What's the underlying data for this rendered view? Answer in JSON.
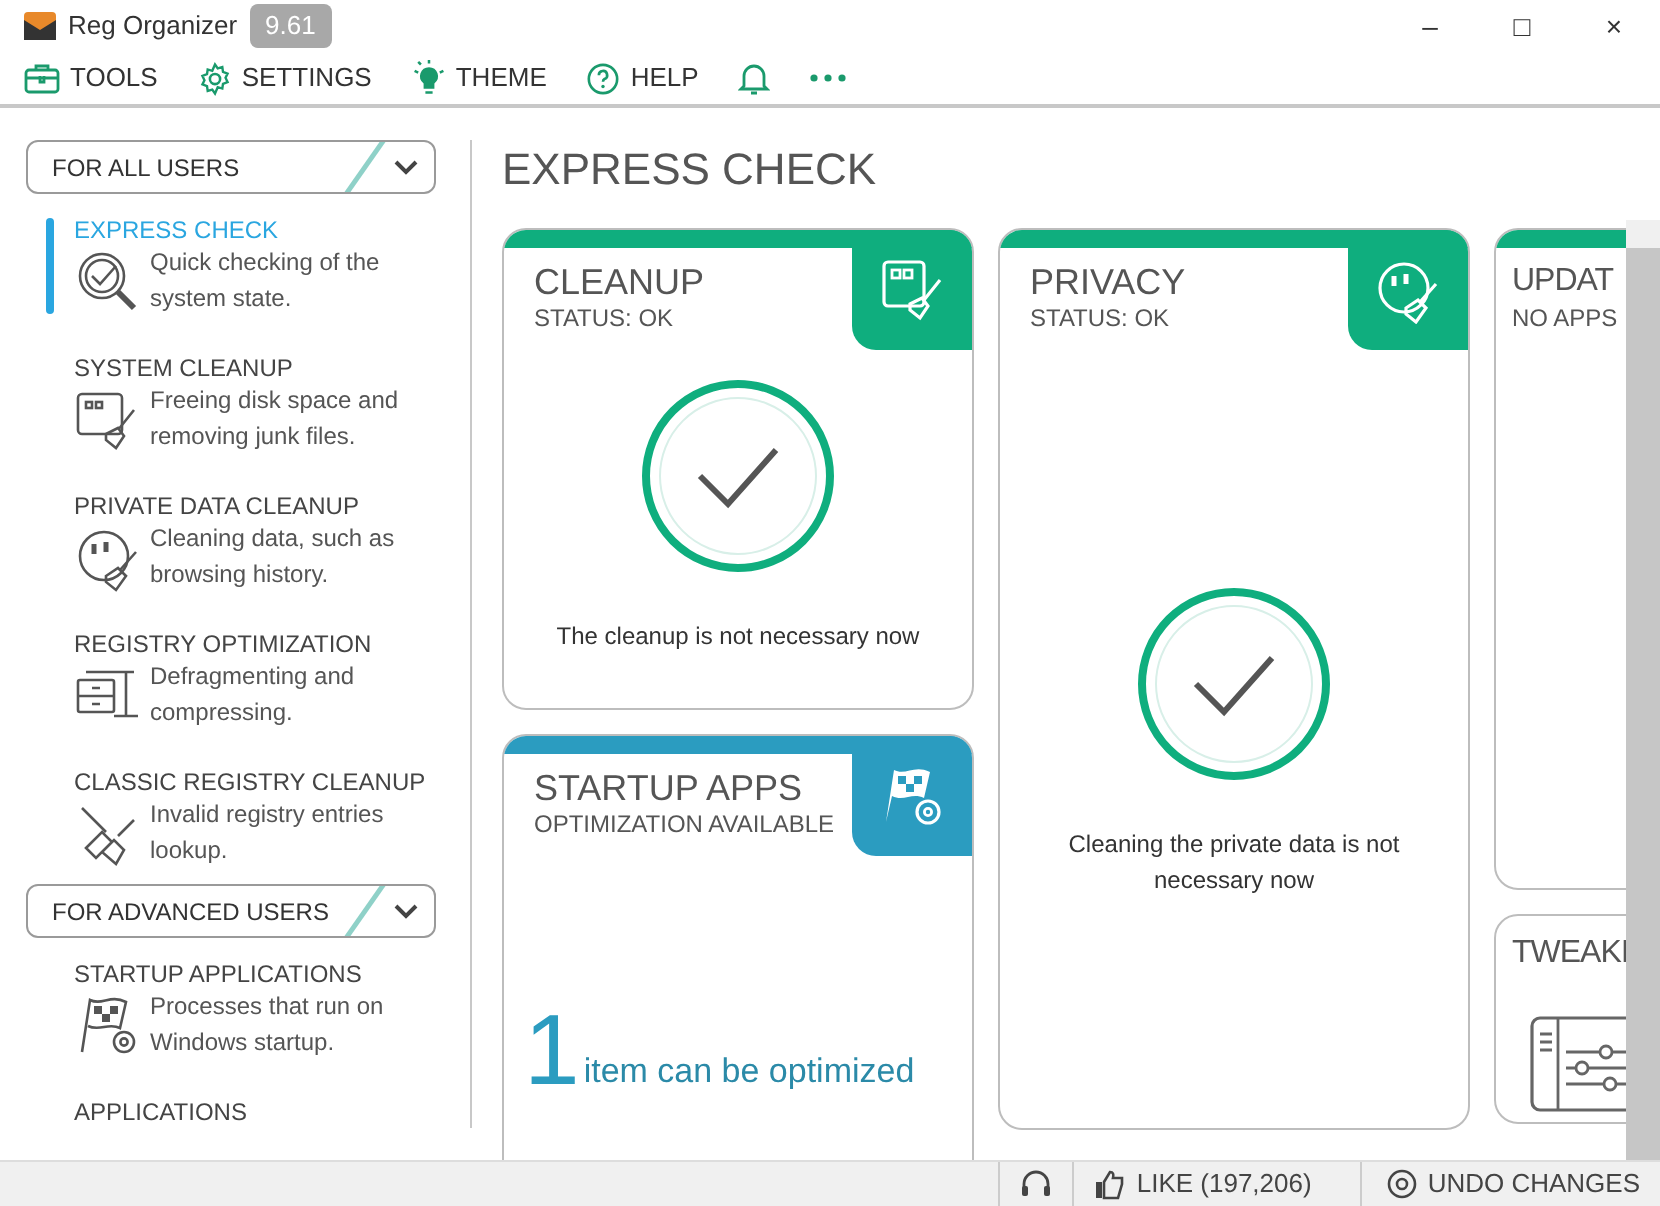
{
  "window": {
    "title": "Reg Organizer",
    "version": "9.61",
    "controls": [
      "–",
      "□",
      "×"
    ]
  },
  "menu": [
    {
      "label": "TOOLS"
    },
    {
      "label": "SETTINGS"
    },
    {
      "label": "THEME"
    },
    {
      "label": "HELP"
    }
  ],
  "sidebar": {
    "groups": [
      {
        "label": "FOR ALL USERS",
        "items": [
          {
            "title": "EXPRESS CHECK",
            "description": "Quick checking of the system state.",
            "selected": true
          },
          {
            "title": "SYSTEM CLEANUP",
            "description": "Freeing disk space and removing junk files.",
            "selected": false
          },
          {
            "title": "PRIVATE DATA CLEANUP",
            "description": "Cleaning data, such as browsing history.",
            "selected": false
          },
          {
            "title": "REGISTRY OPTIMIZATION",
            "description": "Defragmenting and compressing.",
            "selected": false
          },
          {
            "title": "CLASSIC REGISTRY CLEANUP",
            "description": "Invalid registry entries lookup.",
            "selected": false
          }
        ]
      },
      {
        "label": "FOR ADVANCED USERS",
        "items": [
          {
            "title": "STARTUP APPLICATIONS",
            "description": "Processes that run on Windows startup.",
            "selected": false
          },
          {
            "title": "APPLICATIONS",
            "selected": false
          }
        ]
      }
    ]
  },
  "main": {
    "title": "EXPRESS CHECK",
    "columns": [
      [
        {
          "kind": "status",
          "title": "CLEANUP",
          "status": "STATUS: OK",
          "color": "#0fae7e",
          "message": "The cleanup is not necessary now"
        },
        {
          "kind": "count",
          "title": "STARTUP APPS",
          "status": "OPTIMIZATION AVAILABLE",
          "color": "#2b9cc0",
          "count": "1",
          "message": "item can be optimized"
        }
      ],
      [
        {
          "kind": "status",
          "title": "PRIVACY",
          "status": "STATUS: OK",
          "color": "#0fae7e",
          "message": "Cleaning the private data is not necessary now"
        }
      ],
      [
        {
          "kind": "header",
          "title": "UPDAT",
          "status": "NO APPS",
          "color": "#0fae7e"
        },
        {
          "kind": "tool",
          "title": "TWEAKI"
        }
      ]
    ]
  },
  "status_bar": {
    "like": "LIKE (197,206)",
    "undo": "UNDO CHANGES"
  }
}
